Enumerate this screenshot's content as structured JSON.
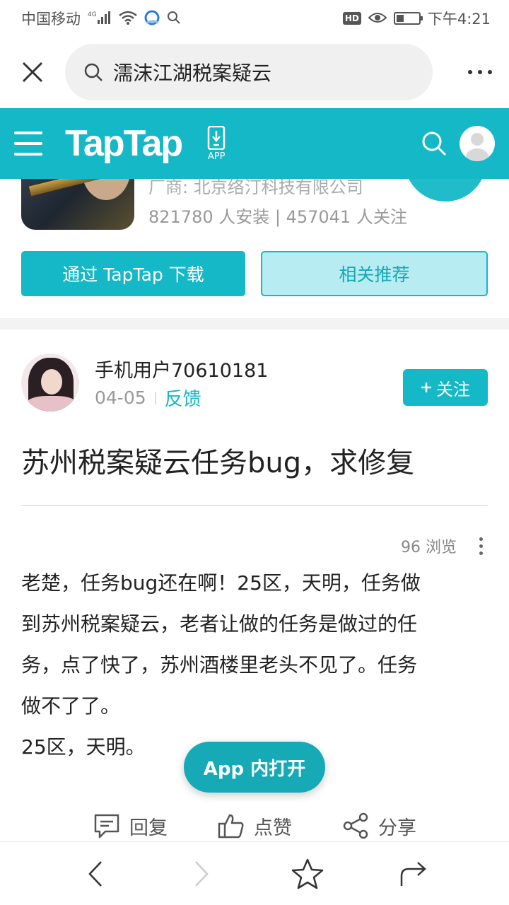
{
  "status_bar": {
    "carrier": "中国移动",
    "network": "4G",
    "time": "下午4:21",
    "hd": "HD",
    "battery_level": 0.35
  },
  "browser": {
    "url_text": "濡沫江湖税案疑云"
  },
  "taptap_header": {
    "logo": "TapTap",
    "app_label": "APP"
  },
  "app_info": {
    "developer": "厂商: 北京络汀科技有限公司",
    "stats": "821780 人安装 | 457041 人关注",
    "download_button": "通过 TapTap 下载",
    "related_button": "相关推荐"
  },
  "post": {
    "author": "手机用户70610181",
    "date": "04-05",
    "tag": "反馈",
    "follow_label": "关注",
    "title": "苏州税案疑云任务bug，求修复",
    "views": "96 浏览",
    "body_lines": [
      "老楚，任务bug还在啊！25区，天明，任务做",
      "到苏州税案疑云，老者让做的任务是做过的任",
      "务，点了快了，苏州酒楼里老头不见了。任务",
      "做不了了。",
      "25区，天明。"
    ]
  },
  "open_app_button": "App 内打开",
  "actions": {
    "reply": "回复",
    "like": "点赞",
    "share": "分享"
  },
  "colors": {
    "brand": "#15b8c6",
    "text": "#222222",
    "muted": "#999999"
  }
}
